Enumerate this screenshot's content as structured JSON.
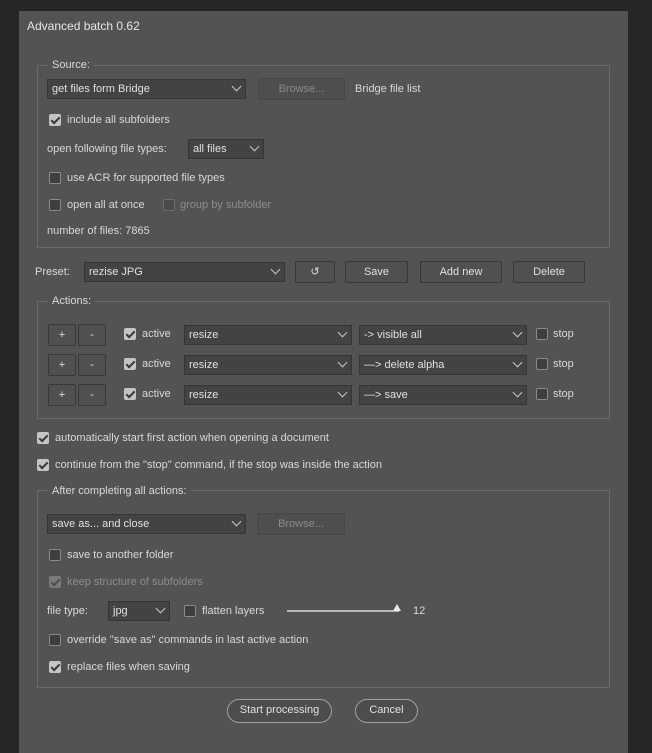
{
  "window": {
    "title": "Advanced batch 0.62"
  },
  "source": {
    "legend": "Source:",
    "source_select": "get files form Bridge",
    "browse_label": "Browse...",
    "bridge_list_label": "Bridge file list",
    "include_subfolders_label": "include all subfolders",
    "include_subfolders_checked": true,
    "file_types_label": "open following file types:",
    "file_types_select": "all files",
    "use_acr_label": "use ACR for supported file types",
    "use_acr_checked": false,
    "open_all_label": "open all at once",
    "open_all_checked": false,
    "group_subfolder_label": "group by subfolder",
    "number_of_files": "number of files: 7865"
  },
  "preset": {
    "label": "Preset:",
    "selected": "rezise JPG",
    "reload_icon": "↺",
    "save_label": "Save",
    "add_new_label": "Add new",
    "delete_label": "Delete"
  },
  "actions": {
    "legend": "Actions:",
    "rows": [
      {
        "plus": "+",
        "minus": "-",
        "active_label": "active",
        "active": true,
        "set": "resize",
        "action": "-> visible all",
        "stop_label": "stop",
        "stop": false
      },
      {
        "plus": "+",
        "minus": "-",
        "active_label": "active",
        "active": true,
        "set": "resize",
        "action": "—> delete alpha",
        "stop_label": "stop",
        "stop": false
      },
      {
        "plus": "+",
        "minus": "-",
        "active_label": "active",
        "active": true,
        "set": "resize",
        "action": "—> save",
        "stop_label": "stop",
        "stop": false
      }
    ]
  },
  "options": {
    "auto_start_label": "automatically start first action when opening a document",
    "auto_start_checked": true,
    "continue_label": "continue from the \"stop\" command, if the stop was inside the action",
    "continue_checked": true
  },
  "after": {
    "legend": "After completing all actions:",
    "mode_select": "save as... and close",
    "browse_label": "Browse...",
    "save_another_label": "save to another folder",
    "save_another_checked": false,
    "keep_structure_label": "keep structure of subfolders",
    "keep_structure_checked": true,
    "file_type_label": "file type:",
    "file_type_select": "jpg",
    "flatten_label": "flatten layers",
    "flatten_checked": false,
    "quality_value": "12",
    "quality_fraction": 0.98,
    "override_label": "override \"save as\" commands in last active action",
    "override_checked": false,
    "replace_label": "replace files when saving",
    "replace_checked": true
  },
  "footer": {
    "start_label": "Start processing",
    "cancel_label": "Cancel"
  }
}
